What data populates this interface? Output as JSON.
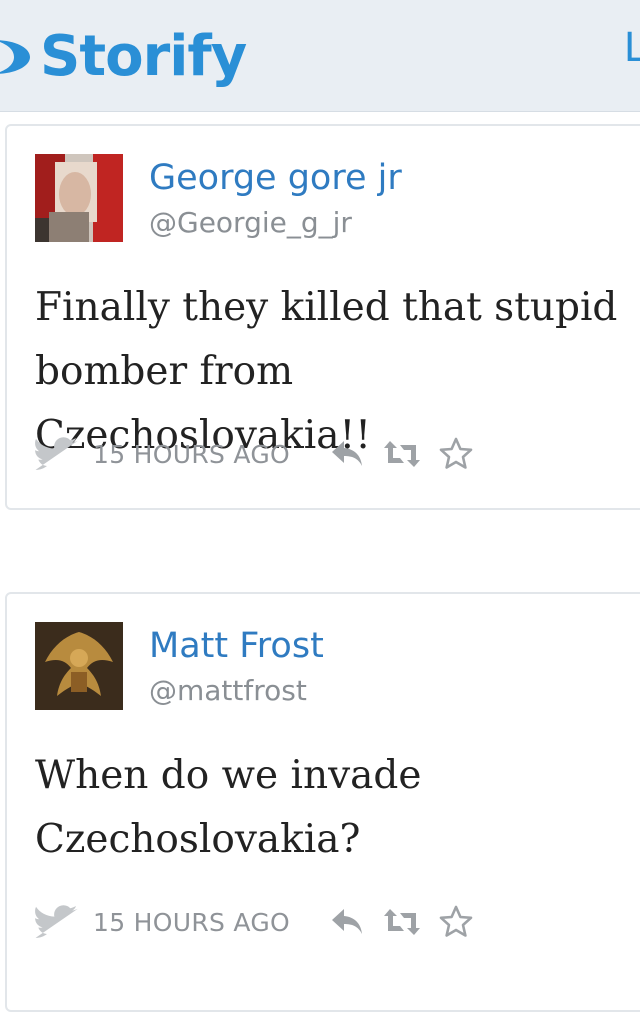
{
  "header": {
    "logo_text": "Storify",
    "right_fragment": "L",
    "brand_color": "#2a8fd6"
  },
  "tweets": [
    {
      "author_name": "George gore jr",
      "author_handle": "@Georgie_g_jr",
      "text": "Finally they killed that stupid bomber from Czechoslovakia!!",
      "time": "15 HOURS AGO",
      "icons": [
        "twitter-bird-icon",
        "reply-icon",
        "retweet-icon",
        "favorite-star-icon"
      ]
    },
    {
      "author_name": "Matt Frost",
      "author_handle": "@mattfrost",
      "text": "When do we invade Czechoslovakia?",
      "time": "15 HOURS AGO",
      "icons": [
        "twitter-bird-icon",
        "reply-icon",
        "retweet-icon",
        "favorite-star-icon"
      ]
    }
  ],
  "colors": {
    "name": "#2f7bc1",
    "handle": "#8a8f94",
    "meta": "#8f9398",
    "header_bg": "#e9eef3"
  }
}
